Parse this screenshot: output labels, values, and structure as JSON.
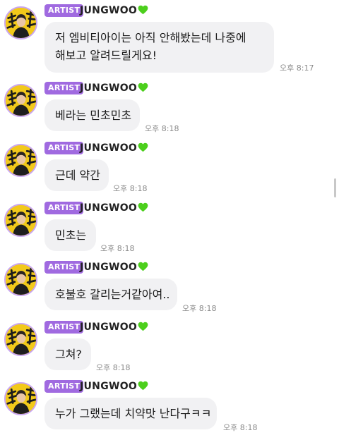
{
  "messages": [
    {
      "badge": "ARTIST",
      "author": "JUNGWOO",
      "lines": [
        "저 엠비티아이는 아직 안해봤는데 나중에",
        "해보고 알려드릴게요!"
      ],
      "time": "오후 8:17"
    },
    {
      "badge": "ARTIST",
      "author": "JUNGWOO",
      "lines": [
        "베라는 민초민초"
      ],
      "time": "오후 8:18"
    },
    {
      "badge": "ARTIST",
      "author": "JUNGWOO",
      "lines": [
        "근데 약간"
      ],
      "time": "오후 8:18"
    },
    {
      "badge": "ARTIST",
      "author": "JUNGWOO",
      "lines": [
        "민초는"
      ],
      "time": "오후 8:18"
    },
    {
      "badge": "ARTIST",
      "author": "JUNGWOO",
      "lines": [
        "호불호 갈리는거같아여.."
      ],
      "time": "오후 8:18"
    },
    {
      "badge": "ARTIST",
      "author": "JUNGWOO",
      "lines": [
        "그쳐?"
      ],
      "time": "오후 8:18"
    },
    {
      "badge": "ARTIST",
      "author": "JUNGWOO",
      "lines": [
        "누가 그랬는데 치약맛 난다구ㅋㅋ"
      ],
      "time": "오후 8:18"
    }
  ],
  "colors": {
    "badge": "#a06ae0",
    "heart": "#4ccf1c",
    "avatar_bg": "#f2c91a",
    "bubble": "#f1f1f3"
  },
  "icons": {
    "heart": "green-heart-icon",
    "avatar": "artist-avatar"
  }
}
